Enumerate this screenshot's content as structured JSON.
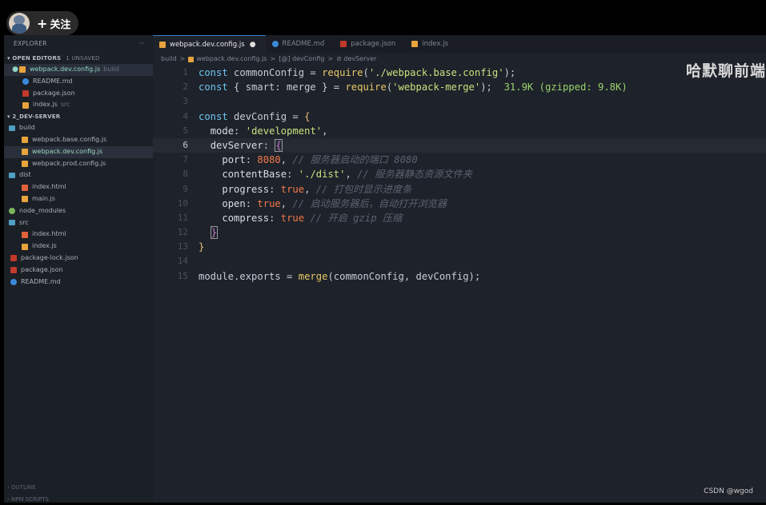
{
  "overlay": {
    "follow_label": "关注",
    "watermark": "哈默聊前端",
    "credit": "CSDN @wgod"
  },
  "sidebar": {
    "title": "EXPLORER",
    "more": "···",
    "open_editors": {
      "label": "OPEN EDITORS",
      "badge": "1 UNSAVED"
    },
    "open_files": [
      {
        "name": "webpack.dev.config.js",
        "hint": "build",
        "icon": "js",
        "active": true
      },
      {
        "name": "README.md",
        "hint": "",
        "icon": "md"
      },
      {
        "name": "package.json",
        "hint": "",
        "icon": "json"
      },
      {
        "name": "index.js",
        "hint": "src",
        "icon": "js"
      }
    ],
    "project": {
      "label": "2_DEV-SERVER"
    },
    "tree": [
      {
        "name": "build",
        "type": "folder"
      },
      {
        "name": "webpack.base.config.js",
        "type": "js"
      },
      {
        "name": "webpack.dev.config.js",
        "type": "js",
        "active": true
      },
      {
        "name": "webpack.prod.config.js",
        "type": "js"
      },
      {
        "name": "dist",
        "type": "folder"
      },
      {
        "name": "index.html",
        "type": "html"
      },
      {
        "name": "main.js",
        "type": "js"
      },
      {
        "name": "node_modules",
        "type": "node"
      },
      {
        "name": "src",
        "type": "folder"
      },
      {
        "name": "index.html",
        "type": "html"
      },
      {
        "name": "index.js",
        "type": "js"
      },
      {
        "name": "package-lock.json",
        "type": "json"
      },
      {
        "name": "package.json",
        "type": "json"
      },
      {
        "name": "README.md",
        "type": "md"
      }
    ],
    "outline": "OUTLINE",
    "npm_scripts": "NPM SCRIPTS"
  },
  "tabs": [
    {
      "label": "webpack.dev.config.js",
      "icon": "js",
      "active": true,
      "unsaved": "●"
    },
    {
      "label": "README.md",
      "icon": "md"
    },
    {
      "label": "package.json",
      "icon": "json"
    },
    {
      "label": "index.js",
      "icon": "js"
    }
  ],
  "breadcrumb": {
    "folder": "build",
    "file": "webpack.dev.config.js",
    "symbol1": "devConfig",
    "symbol2": "devServer",
    "sep": ">"
  },
  "code": {
    "line_numbers": [
      "1",
      "2",
      "3",
      "4",
      "5",
      "6",
      "7",
      "8",
      "9",
      "10",
      "11",
      "12",
      "13",
      "14",
      "15"
    ],
    "cost_hint": "31.9K (gzipped: 9.8K)",
    "comments": {
      "port": "// 服务器启动的端口 8080",
      "contentBase": "// 服务器静态资源文件夹",
      "progress": "// 打包时显示进度条",
      "open": "// 启动服务器后，自动打开浏览器",
      "compress": "// 开启 gzip 压缩"
    }
  },
  "colors": {
    "editor_bg": "#1e222a",
    "sidebar_bg": "#1b1f26",
    "keyword": "#6ec4f0",
    "function": "#e9c96a",
    "string": "#c6e37f",
    "number": "#f2784b",
    "comment": "#5b6270"
  }
}
